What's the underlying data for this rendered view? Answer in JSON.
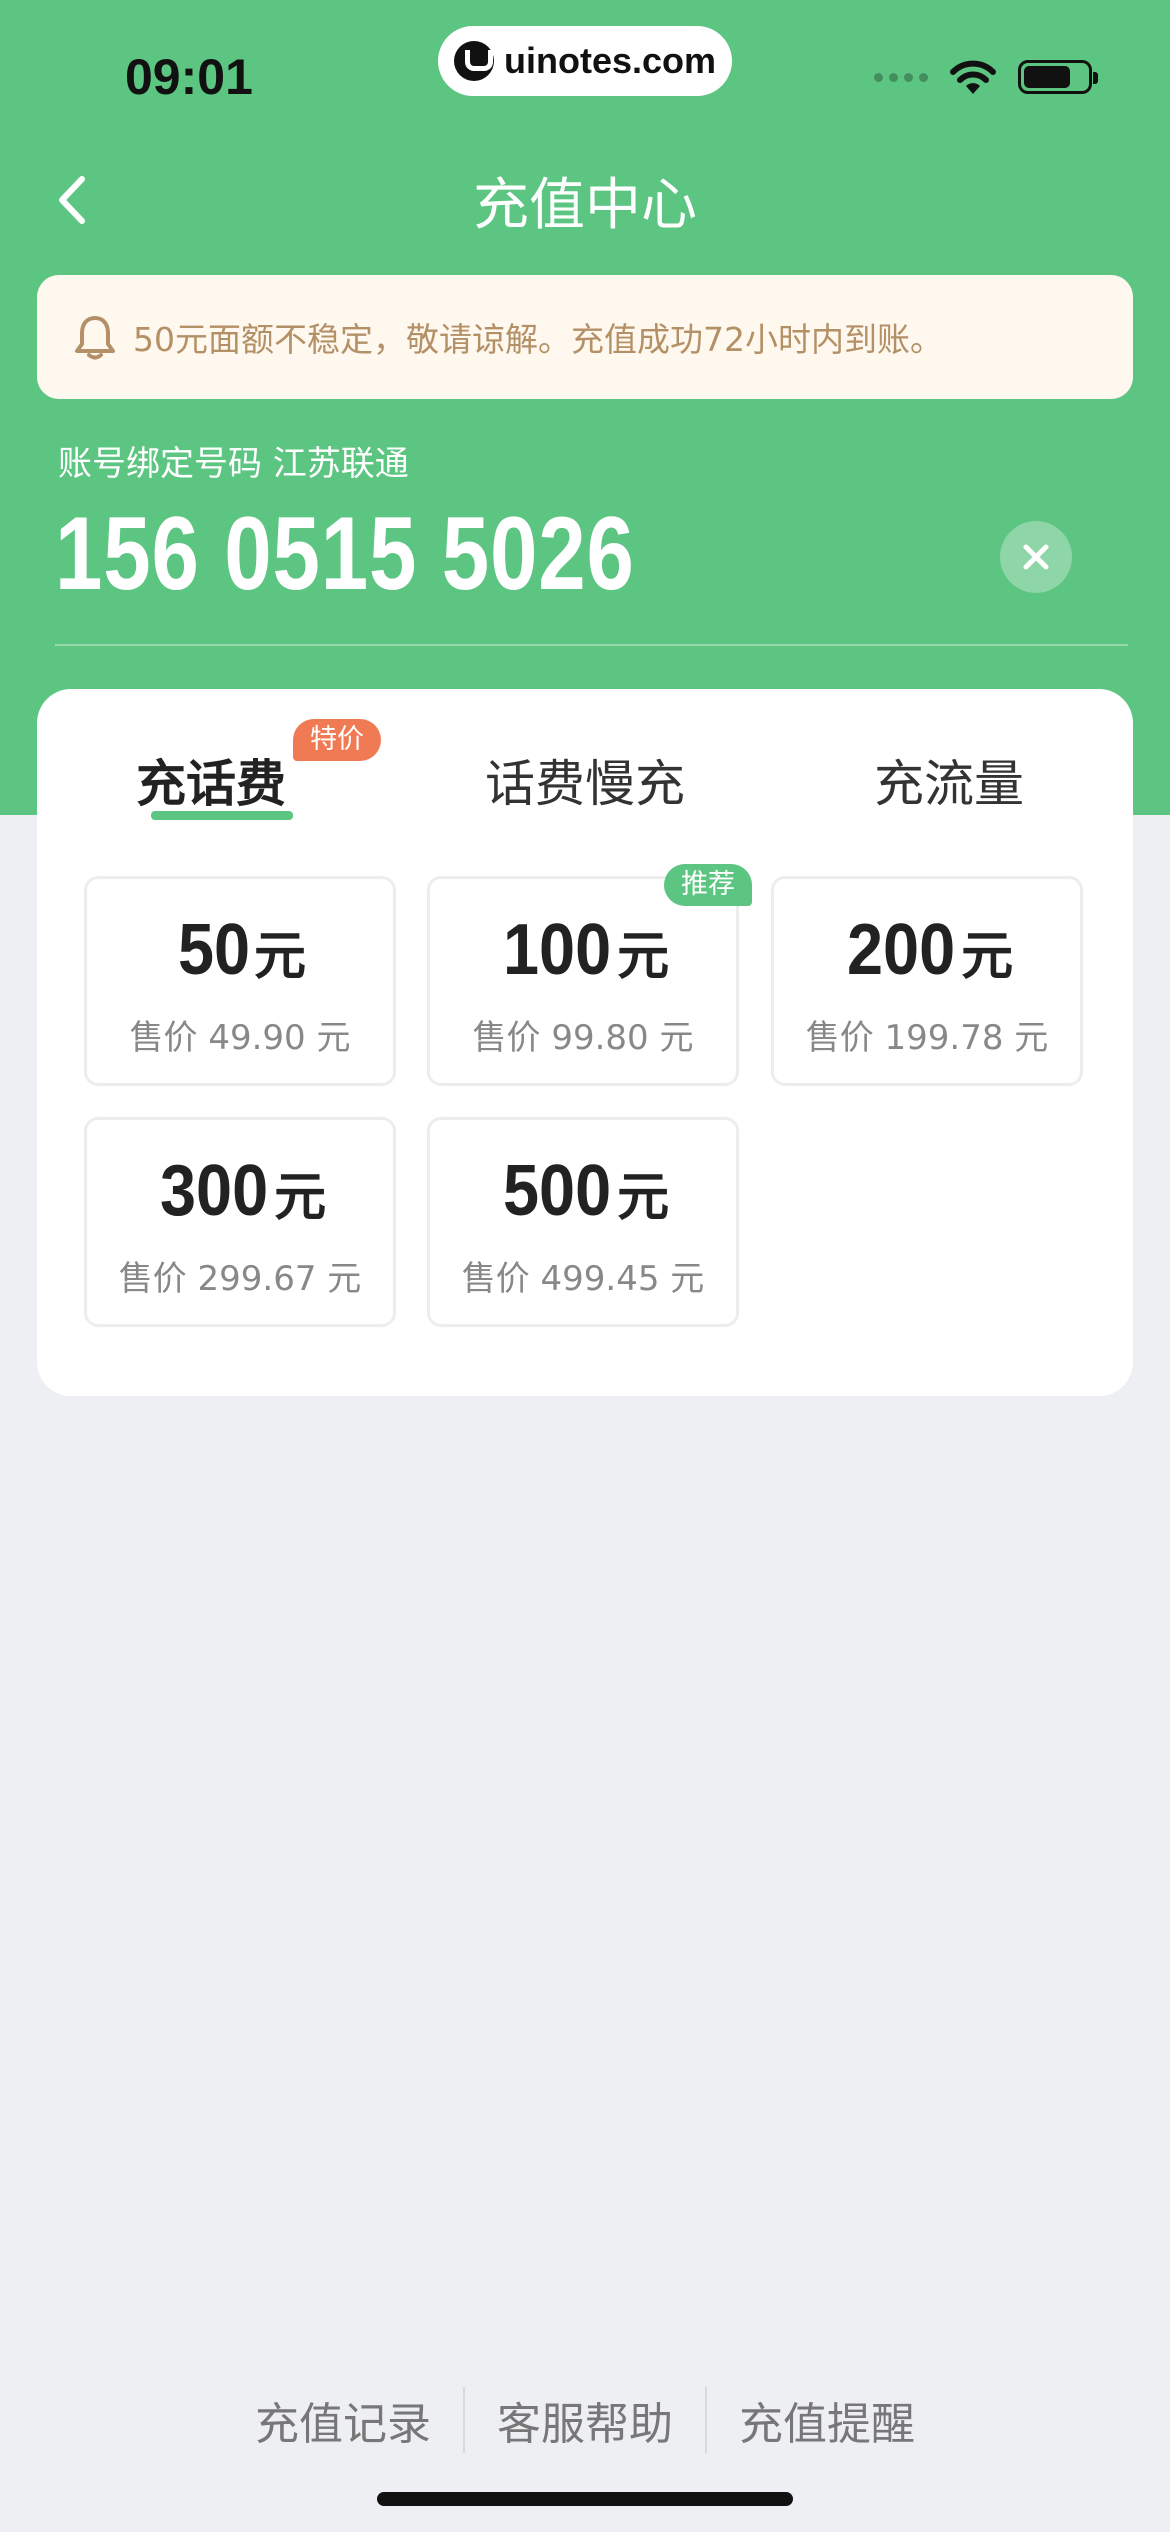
{
  "status_bar": {
    "time": "09:01",
    "watermark": "uinotes.com"
  },
  "nav": {
    "title": "充值中心"
  },
  "notice": {
    "text": "50元面额不稳定，敬请谅解。充值成功72小时内到账。"
  },
  "account": {
    "label": "账号绑定号码 江苏联通",
    "phone": "156 0515 5026"
  },
  "tabs": [
    {
      "label": "充话费",
      "active": true,
      "badge": "特价"
    },
    {
      "label": "话费慢充",
      "active": false
    },
    {
      "label": "充流量",
      "active": false
    }
  ],
  "options": [
    {
      "amount": "50",
      "unit": "元",
      "price": "售价 49.90 元"
    },
    {
      "amount": "100",
      "unit": "元",
      "price": "售价 99.80 元",
      "badge": "推荐"
    },
    {
      "amount": "200",
      "unit": "元",
      "price": "售价 199.78 元"
    },
    {
      "amount": "300",
      "unit": "元",
      "price": "售价 299.67 元"
    },
    {
      "amount": "500",
      "unit": "元",
      "price": "售价 499.45 元"
    }
  ],
  "footer": {
    "links": [
      "充值记录",
      "客服帮助",
      "充值提醒"
    ]
  },
  "colors": {
    "brand_green": "#5dc582",
    "notice_bg": "#fef8ef",
    "notice_text": "#b49066",
    "badge_orange": "#ef7a53"
  },
  "icons": {
    "back": "chevron-left-icon",
    "notice": "bell-icon",
    "clear": "close-icon"
  }
}
